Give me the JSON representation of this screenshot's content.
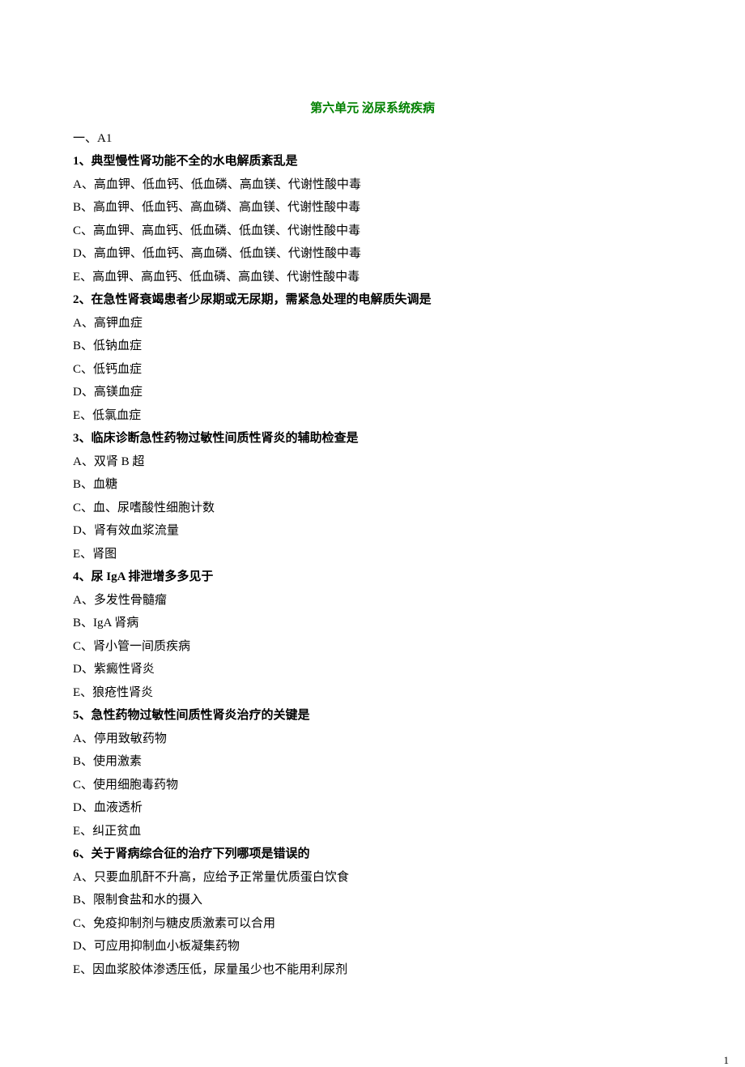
{
  "title": "第六单元 泌尿系统疾病",
  "section_label": "一、A1",
  "questions": [
    {
      "q": "1、典型慢性肾功能不全的水电解质紊乱是",
      "opts": [
        "A、高血钾、低血钙、低血磷、高血镁、代谢性酸中毒",
        "B、高血钾、低血钙、高血磷、高血镁、代谢性酸中毒",
        "C、高血钾、高血钙、低血磷、低血镁、代谢性酸中毒",
        "D、高血钾、低血钙、高血磷、低血镁、代谢性酸中毒",
        "E、高血钾、高血钙、低血磷、高血镁、代谢性酸中毒"
      ]
    },
    {
      "q": "2、在急性肾衰竭患者少尿期或无尿期，需紧急处理的电解质失调是",
      "opts": [
        "A、高钾血症",
        "B、低钠血症",
        "C、低钙血症",
        "D、高镁血症",
        "E、低氯血症"
      ]
    },
    {
      "q": "3、临床诊断急性药物过敏性间质性肾炎的辅助检查是",
      "opts": [
        "A、双肾 B 超",
        "B、血糖",
        "C、血、尿嗜酸性细胞计数",
        "D、肾有效血浆流量",
        "E、肾图"
      ]
    },
    {
      "q": "4、尿 IgA 排泄增多多见于",
      "opts": [
        "A、多发性骨髓瘤",
        "B、IgA 肾病",
        "C、肾小管一间质疾病",
        "D、紫癜性肾炎",
        "E、狼疮性肾炎"
      ]
    },
    {
      "q": "5、急性药物过敏性间质性肾炎治疗的关键是",
      "opts": [
        "A、停用致敏药物",
        "B、使用激素",
        "C、使用细胞毒药物",
        "D、血液透析",
        "E、纠正贫血"
      ]
    },
    {
      "q": "6、关于肾病综合征的治疗下列哪项是错误的",
      "opts": [
        "A、只要血肌酐不升高，应给予正常量优质蛋白饮食",
        "B、限制食盐和水的摄入",
        "C、免疫抑制剂与糖皮质激素可以合用",
        "D、可应用抑制血小板凝集药物",
        "E、因血浆胶体渗透压低，尿量虽少也不能用利尿剂"
      ]
    }
  ],
  "page_number": "1"
}
